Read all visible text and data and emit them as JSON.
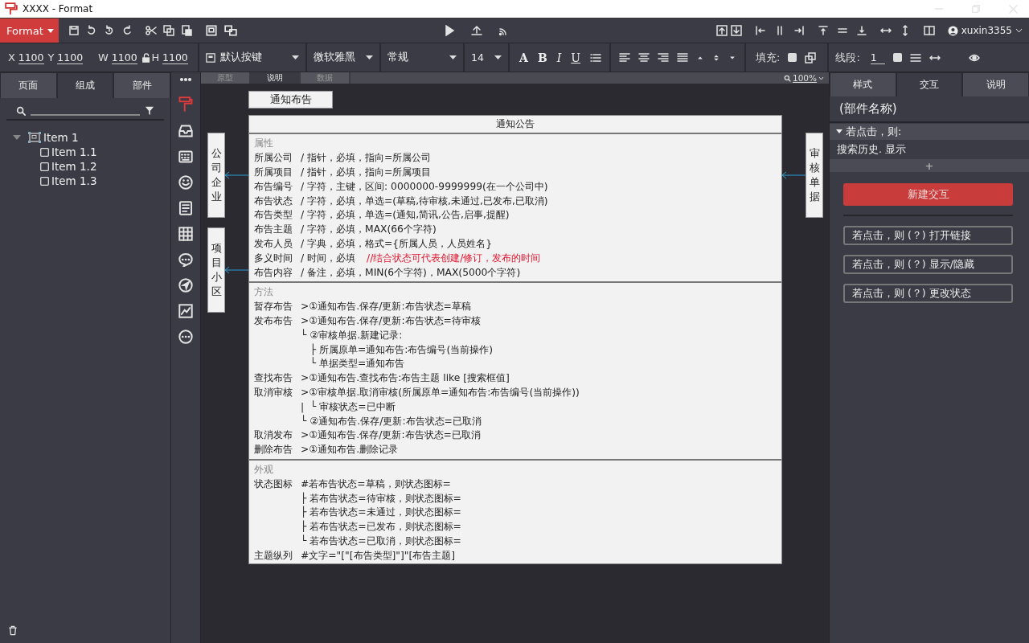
{
  "window": {
    "title": "XXXX - Format"
  },
  "toolbar": {
    "format_menu": "Format",
    "user": "xuxin3355"
  },
  "properties": {
    "fields": [
      {
        "label": "X",
        "value": "1100"
      },
      {
        "label": "Y",
        "value": "1100"
      },
      {
        "label": "W",
        "value": "1100"
      },
      {
        "label": "H",
        "value": "1100"
      }
    ],
    "dropdowns": [
      {
        "kind": "widget",
        "value": "默认按键"
      },
      {
        "kind": "plain",
        "value": "微软雅黑"
      },
      {
        "kind": "plain",
        "value": "常规"
      },
      {
        "kind": "plain",
        "value": "14"
      }
    ],
    "text_styles": [
      "A",
      "B",
      "I",
      "U"
    ],
    "fill_label": "填充:",
    "line_label": "线段:",
    "line_value": "1"
  },
  "left_panel": {
    "tabs": [
      {
        "label": "页面",
        "selected": false
      },
      {
        "label": "组成",
        "selected": true
      },
      {
        "label": "部件",
        "selected": false
      }
    ],
    "tree": [
      {
        "label": "Item 1",
        "expanded": true,
        "children": [
          {
            "label": "Item 1.1"
          },
          {
            "label": "Item 1.2"
          },
          {
            "label": "Item 1.3"
          }
        ]
      }
    ]
  },
  "canvas": {
    "tabs": [
      {
        "label": "原型",
        "selected": false
      },
      {
        "label": "说明",
        "selected": true
      },
      {
        "label": "数据",
        "selected": false
      }
    ],
    "zoom": "100%",
    "button": "通知布告",
    "left_boxes": [
      "公司企业",
      "项目小区"
    ],
    "right_boxes": [
      "审核单据"
    ],
    "table": {
      "title": "通知公告",
      "sections": [
        {
          "heading": "属性",
          "rows": [
            {
              "label": "所属公司",
              "text": "/ 指针，必填，指向=所属公司"
            },
            {
              "label": "所属项目",
              "text": "/ 指针，必填，指向=所属项目"
            },
            {
              "label": "布告编号",
              "text": "/ 字符，主键，区间: 0000000-9999999(在一个公司中)"
            },
            {
              "label": "布告状态",
              "text": "/ 字符，必填，单选=(草稿,待审核,未通过,已发布,已取消)"
            },
            {
              "label": "布告类型",
              "text": "/ 字符，必填，单选=(通知,简讯,公告,启事,提醒)"
            },
            {
              "label": "布告主题",
              "text": "/ 字符，必填，MAX(66个字符)"
            },
            {
              "label": "发布人员",
              "text": "/ 字典，必填，格式={所属人员，人员姓名}"
            },
            {
              "label": "多义时间",
              "text": "/ 时间，必填",
              "note": "//结合状态可代表创建/修订，发布的时间"
            },
            {
              "label": "布告内容",
              "text": "/ 备注，必填，MIN(6个字符)，MAX(5000个字符)"
            }
          ]
        },
        {
          "heading": "方法",
          "rows": [
            {
              "label": "暂存布告",
              "text": ">①通知布告.保存/更新:布告状态=草稿"
            },
            {
              "label": "发布布告",
              "text": ">①通知布告.保存/更新:布告状态=待审核"
            },
            {
              "text": "└ ②审核单据.新建记录:"
            },
            {
              "text": "   ├ 所属原单=通知布告:布告编号(当前操作)"
            },
            {
              "text": "   └ 单据类型=通知布告"
            },
            {
              "label": "查找布告",
              "text": ">①通知布告.查找布告:布告主题 like [搜索框值]"
            },
            {
              "label": "取消审核",
              "text": ">①审核单据.取消审核(所属原单=通知布告:布告编号(当前操作))"
            },
            {
              "text": "|  └ 审核状态=已中断"
            },
            {
              "text": "└ ②通知布告.保存/更新:布告状态=已取消"
            },
            {
              "label": "取消发布",
              "text": ">①通知布告.保存/更新:布告状态=已取消"
            },
            {
              "label": "删除布告",
              "text": ">①通知布告.删除记录"
            }
          ]
        },
        {
          "heading": "外观",
          "rows": [
            {
              "label": "状态图标",
              "text": "#若布告状态=草稿，则状态图标="
            },
            {
              "text": "├ 若布告状态=待审核，则状态图标="
            },
            {
              "text": "├ 若布告状态=未通过，则状态图标="
            },
            {
              "text": "├ 若布告状态=已发布，则状态图标="
            },
            {
              "text": "└ 若布告状态=已取消，则状态图标="
            },
            {
              "label": "主题纵列",
              "text": "#文字=\"[\"[布告类型]\"]\"[布告主题]"
            }
          ]
        }
      ]
    }
  },
  "right_panel": {
    "tabs": [
      {
        "label": "样式",
        "selected": false
      },
      {
        "label": "交互",
        "selected": true
      },
      {
        "label": "说明",
        "selected": false
      }
    ],
    "component_name": "(部件名称)",
    "event": {
      "label": "若点击，则:",
      "expanded": true
    },
    "action": "搜索历史. 显示",
    "add": "+",
    "new_button": "新建交互",
    "presets": [
      "若点击，则 (？) 打开链接",
      "若点击，则 (？) 显示/隐藏",
      "若点击，则 (？) 更改状态"
    ]
  }
}
